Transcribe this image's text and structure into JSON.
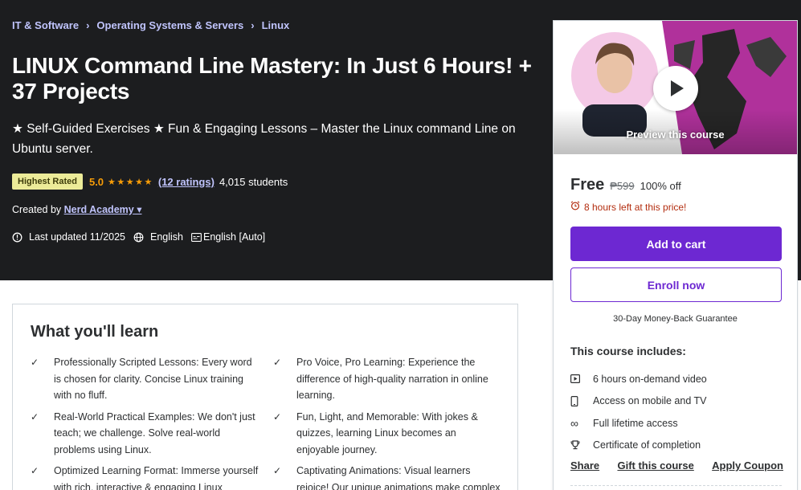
{
  "breadcrumb": [
    "IT & Software",
    "Operating Systems & Servers",
    "Linux"
  ],
  "course": {
    "title": "LINUX Command Line Mastery: In Just 6 Hours! + 37 Projects",
    "subtitle": "★ Self-Guided Exercises ★ Fun & Engaging Lessons – Master the Linux command Line on Ubuntu server.",
    "badge": "Highest Rated",
    "rating": "5.0",
    "stars": "★★★★★",
    "ratings_link": "(12 ratings)",
    "students": "4,015 students",
    "created_by_label": "Created by",
    "author": "Nerd Academy",
    "last_updated": "Last updated 11/2025",
    "language": "English",
    "captions": "English [Auto]"
  },
  "sidebar": {
    "preview_label": "Preview this course",
    "price": "Free",
    "original_price": "₱599",
    "discount": "100% off",
    "timer": "8 hours left at this price!",
    "add_to_cart": "Add to cart",
    "enroll": "Enroll now",
    "guarantee": "30-Day Money-Back Guarantee",
    "includes_title": "This course includes:",
    "includes": [
      {
        "icon": "video-icon",
        "text": "6 hours on-demand video"
      },
      {
        "icon": "mobile-icon",
        "text": "Access on mobile and TV"
      },
      {
        "icon": "infinity-icon",
        "text": "Full lifetime access"
      },
      {
        "icon": "trophy-icon",
        "text": "Certificate of completion"
      }
    ],
    "actions": [
      "Share",
      "Gift this course",
      "Apply Coupon"
    ]
  },
  "learn": {
    "title": "What you'll learn",
    "items": [
      "Professionally Scripted Lessons: Every word is chosen for clarity. Concise Linux training with no fluff.",
      "Pro Voice, Pro Learning: Experience the difference of high-quality narration in online learning.",
      "Real-World Practical Examples: We don't just teach; we challenge. Solve real-world problems using Linux.",
      "Fun, Light, and Memorable: With jokes & quizzes, learning Linux becomes an enjoyable journey.",
      "Optimized Learning Format: Immerse yourself with rich, interactive & engaging Linux",
      "Captivating Animations: Visual learners rejoice! Our unique animations make complex"
    ]
  },
  "colors": {
    "hero_bg": "#1c1d1f",
    "link": "#c0c4fc",
    "star": "#f69c08",
    "primary": "#6d28d2",
    "badge_bg": "#eceb98",
    "timer": "#b32d0f"
  }
}
